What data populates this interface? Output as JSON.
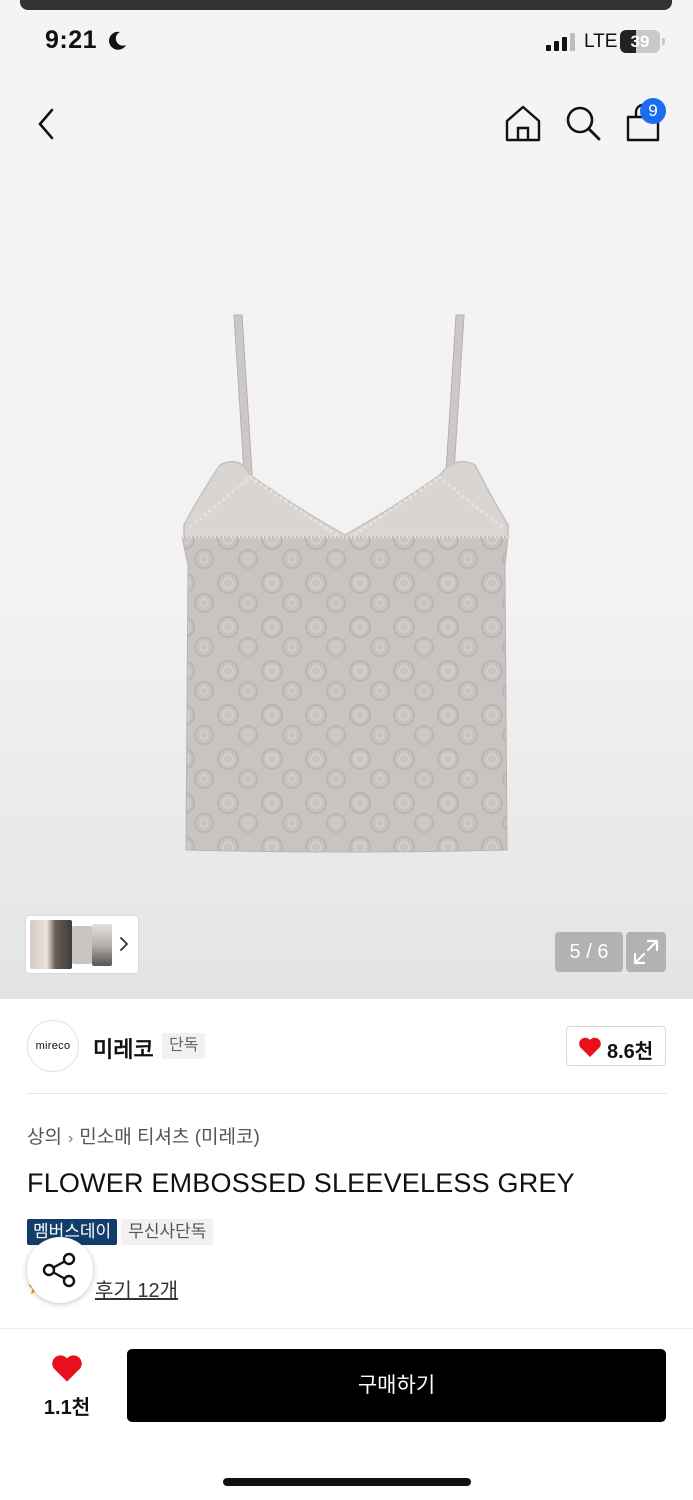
{
  "status_bar": {
    "time": "9:21",
    "network": "LTE",
    "battery_level": "39",
    "battery_fraction": 0.39,
    "icons": [
      "moon-icon",
      "signal-icon",
      "battery-icon"
    ]
  },
  "nav": {
    "icons": [
      "back-arrow-icon",
      "home-icon",
      "search-icon",
      "cart-icon"
    ],
    "cart_badge": "9"
  },
  "gallery": {
    "page_counter": "5 / 6",
    "image_description_icon": "product-image",
    "expand_icon": "expand-icon"
  },
  "brand": {
    "logo_text": "mireco",
    "name": "미레코",
    "tag": "단독",
    "like_count": "8.6천"
  },
  "breadcrumb": {
    "category": "상의",
    "subcategory": "민소매 티셔츠 (미레코)"
  },
  "product": {
    "title": "FLOWER EMBOSSED SLEEVELESS GREY",
    "badges": [
      "멤버스데이",
      "무신사단독"
    ],
    "review_text": "후기 12개"
  },
  "bottom_bar": {
    "wish_count": "1.1천",
    "buy_label": "구매하기"
  },
  "colors": {
    "accent_blue": "#1a6cf0",
    "heart_red": "#e8101c",
    "badge_navy": "#123c6b",
    "buy_black": "#000000"
  }
}
